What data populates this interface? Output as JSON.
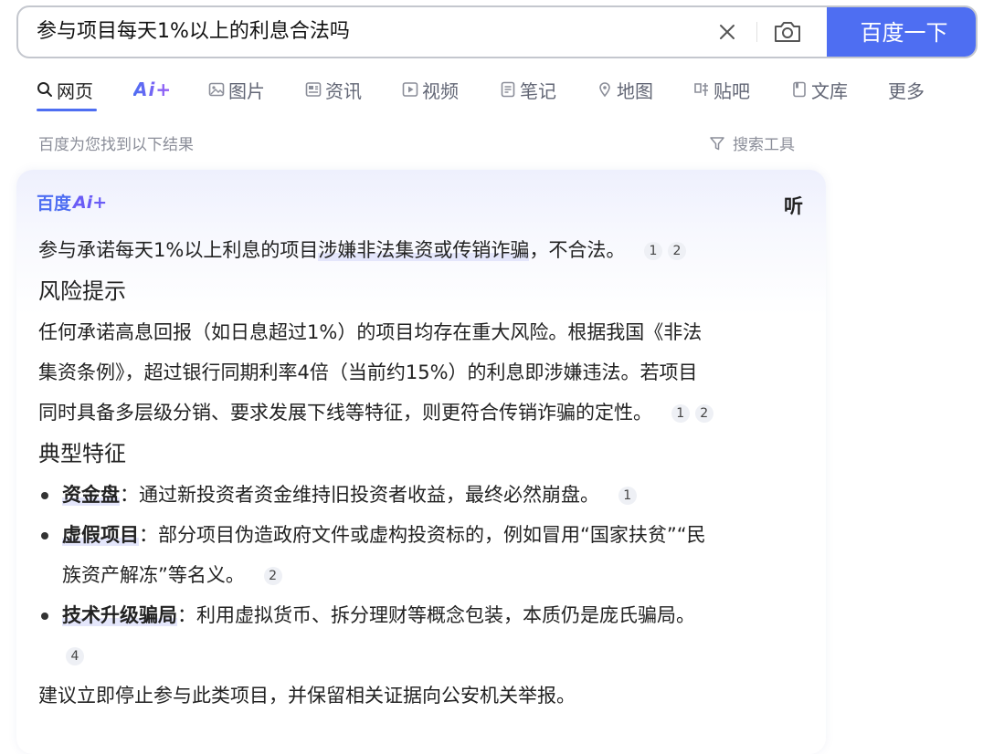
{
  "search": {
    "query": "参与项目每天1%以上的利息合法吗",
    "button_label": "百度一下"
  },
  "tabs": [
    {
      "label": "网页",
      "icon": "search-icon",
      "active": true
    },
    {
      "label": "Ai+",
      "icon": "ai-icon"
    },
    {
      "label": "图片",
      "icon": "image-icon"
    },
    {
      "label": "资讯",
      "icon": "news-icon"
    },
    {
      "label": "视频",
      "icon": "video-icon"
    },
    {
      "label": "笔记",
      "icon": "note-icon"
    },
    {
      "label": "地图",
      "icon": "map-icon"
    },
    {
      "label": "贴吧",
      "icon": "tieba-icon"
    },
    {
      "label": "文库",
      "icon": "library-icon"
    },
    {
      "label": "更多",
      "icon": ""
    }
  ],
  "results_info": "百度为您找到以下结果",
  "search_tools": "搜索工具",
  "ai_card": {
    "logo_text": "百度",
    "logo_ai": "Ai+",
    "listen_label": "听",
    "summary": {
      "before": "参与承诺每天1%以上利息的项目",
      "highlight": "涉嫌非法集资或传销诈骗",
      "after": "，不合法。",
      "refs": [
        "1",
        "2"
      ]
    },
    "risk": {
      "title": "风险提示",
      "lines": [
        "任何承诺高息回报（如日息超过1%）的项目均存在重大风险。根据我国《非法",
        "集资条例》，超过银行同期利率4倍（当前约15%）的利息即涉嫌违法。若项目",
        "同时具备多层级分销、要求发展下线等特征，则更符合传销诈骗的定性。"
      ],
      "refs": [
        "1",
        "2"
      ]
    },
    "features": {
      "title": "典型特征",
      "items": [
        {
          "term": "资金盘",
          "lines": [
            "：通过新投资者资金维持旧投资者收益，最终必然崩盘。"
          ],
          "refs": [
            "1"
          ]
        },
        {
          "term": "虚假项目",
          "lines": [
            "：部分项目伪造政府文件或虚构投资标的，例如冒用“国家扶贫”“民",
            "族资产解冻”等名义。"
          ],
          "refs": [
            "2"
          ]
        },
        {
          "term": "技术升级骗局",
          "lines": [
            "：利用虚拟货币、拆分理财等概念包装，本质仍是庞氏骗局。"
          ],
          "refs": [
            "4"
          ]
        }
      ]
    },
    "advice": "建议立即停止参与此类项目，并保留相关证据向公安机关举报。"
  }
}
